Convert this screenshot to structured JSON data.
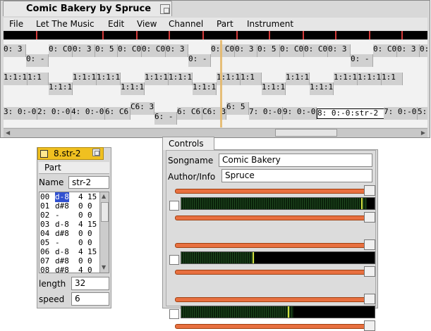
{
  "main": {
    "title": "Comic Bakery by Spruce",
    "menu": [
      "File",
      "Let The Music",
      "Edit",
      "View",
      "Channel",
      "Part",
      "Instrument"
    ],
    "lanes": [
      {
        "cells": [
          {
            "t": "0: 3",
            "r": "high"
          },
          {
            "t": "0: -",
            "r": "low"
          },
          {
            "t": "0: C0",
            "r": "high"
          },
          {
            "t": "0: 3",
            "r": "high"
          },
          {
            "t": "0: 5",
            "r": "high"
          },
          {
            "t": "0: C0",
            "r": "high"
          },
          {
            "t": "0: C0",
            "r": "high"
          },
          {
            "t": "0: 3",
            "r": "high"
          },
          {
            "t": "0: -",
            "r": "low"
          },
          {
            "t": "0: C0",
            "r": "high"
          },
          {
            "t": "0: 3",
            "r": "high"
          },
          {
            "t": "0: 5",
            "r": "high"
          },
          {
            "t": "0: C0",
            "r": "high"
          },
          {
            "t": "0: C0",
            "r": "high"
          },
          {
            "t": "0: 3",
            "r": "high"
          },
          {
            "t": "0: -",
            "r": "low"
          },
          {
            "t": "0: C0",
            "r": "high"
          },
          {
            "t": "0: 3",
            "r": "high"
          },
          {
            "t": "0: 5",
            "r": "high"
          },
          {
            "t": "0: C0",
            "r": "high"
          },
          {
            "t": "0: C0",
            "r": "high"
          }
        ]
      },
      {
        "cells": [
          {
            "t": "1:1:1",
            "r": "high"
          },
          {
            "t": "1:1",
            "r": "high"
          },
          {
            "t": "1:1:1",
            "r": "low"
          },
          {
            "t": "1:1:1",
            "r": "high"
          },
          {
            "t": "1:1:1",
            "r": "high"
          },
          {
            "t": "1:1:1",
            "r": "low"
          },
          {
            "t": "1:1:1",
            "r": "high"
          },
          {
            "t": "1:1:1",
            "r": "high"
          },
          {
            "t": "1:1:1",
            "r": "low"
          },
          {
            "t": "1:1:1",
            "r": "high"
          },
          {
            "t": "1:1",
            "r": "high"
          },
          {
            "t": "1:1:1",
            "r": "low"
          },
          {
            "t": "1:1:1",
            "r": "high"
          },
          {
            "t": "1:1:1",
            "r": "low"
          },
          {
            "t": "1:1:1",
            "r": "high"
          },
          {
            "t": "1:1:1",
            "r": "high"
          },
          {
            "t": "1:1",
            "r": "high"
          }
        ]
      },
      {
        "cells": [
          {
            "t": "3: 0:-0:",
            "r": "mid"
          },
          {
            "t": "2: 0:-0:",
            "r": "mid"
          },
          {
            "t": "4: 0:-0:",
            "r": "mid"
          },
          {
            "t": "6: C6:",
            "r": "mid"
          },
          {
            "t": "C6: 3",
            "r": "high"
          },
          {
            "t": "6: -",
            "r": "low"
          },
          {
            "t": "6: C6:",
            "r": "mid"
          },
          {
            "t": "C6: 3",
            "r": "mid"
          },
          {
            "t": "6: 5",
            "r": "high"
          },
          {
            "t": "7: 0:-0:",
            "r": "mid"
          },
          {
            "t": "9: 0:-0:",
            "r": "mid"
          },
          {
            "t": "8: 0:-0:str-2",
            "r": "sel"
          },
          {
            "t": "7: 0:-0:",
            "r": "mid"
          },
          {
            "t": "5: 0:-0:",
            "r": "mid"
          }
        ]
      }
    ]
  },
  "part": {
    "window_title": "8.str-2",
    "section": "Part",
    "name_label": "Name",
    "name_value": "str-2",
    "rows": [
      {
        "n": "00",
        "note": "d-8",
        "a": "4",
        "b": "15",
        "sel": true
      },
      {
        "n": "01",
        "note": "d#8",
        "a": "0",
        "b": "0"
      },
      {
        "n": "02",
        "note": "-",
        "a": "0",
        "b": "0"
      },
      {
        "n": "03",
        "note": "d-8",
        "a": "4",
        "b": "15"
      },
      {
        "n": "04",
        "note": "d#8",
        "a": "0",
        "b": "0"
      },
      {
        "n": "05",
        "note": "-",
        "a": "0",
        "b": "0"
      },
      {
        "n": "06",
        "note": "d-8",
        "a": "4",
        "b": "15"
      },
      {
        "n": "07",
        "note": "d#8",
        "a": "0",
        "b": "0"
      },
      {
        "n": "08",
        "note": "d#8",
        "a": "4",
        "b": "0"
      }
    ],
    "length_label": "length",
    "length_value": "32",
    "speed_label": "speed",
    "speed_value": "6"
  },
  "controls": {
    "tab": "Controls",
    "songname_label": "Songname",
    "songname_value": "Comic Bakery",
    "author_label": "Author/Info",
    "author_value": "Spruce",
    "channels": [
      {
        "meter_level": 0.96,
        "peak": 0.93
      },
      {
        "meter_level": 0.38,
        "peak": 0.37
      },
      {
        "meter_level": 0.58,
        "peak": 0.55
      }
    ]
  }
}
